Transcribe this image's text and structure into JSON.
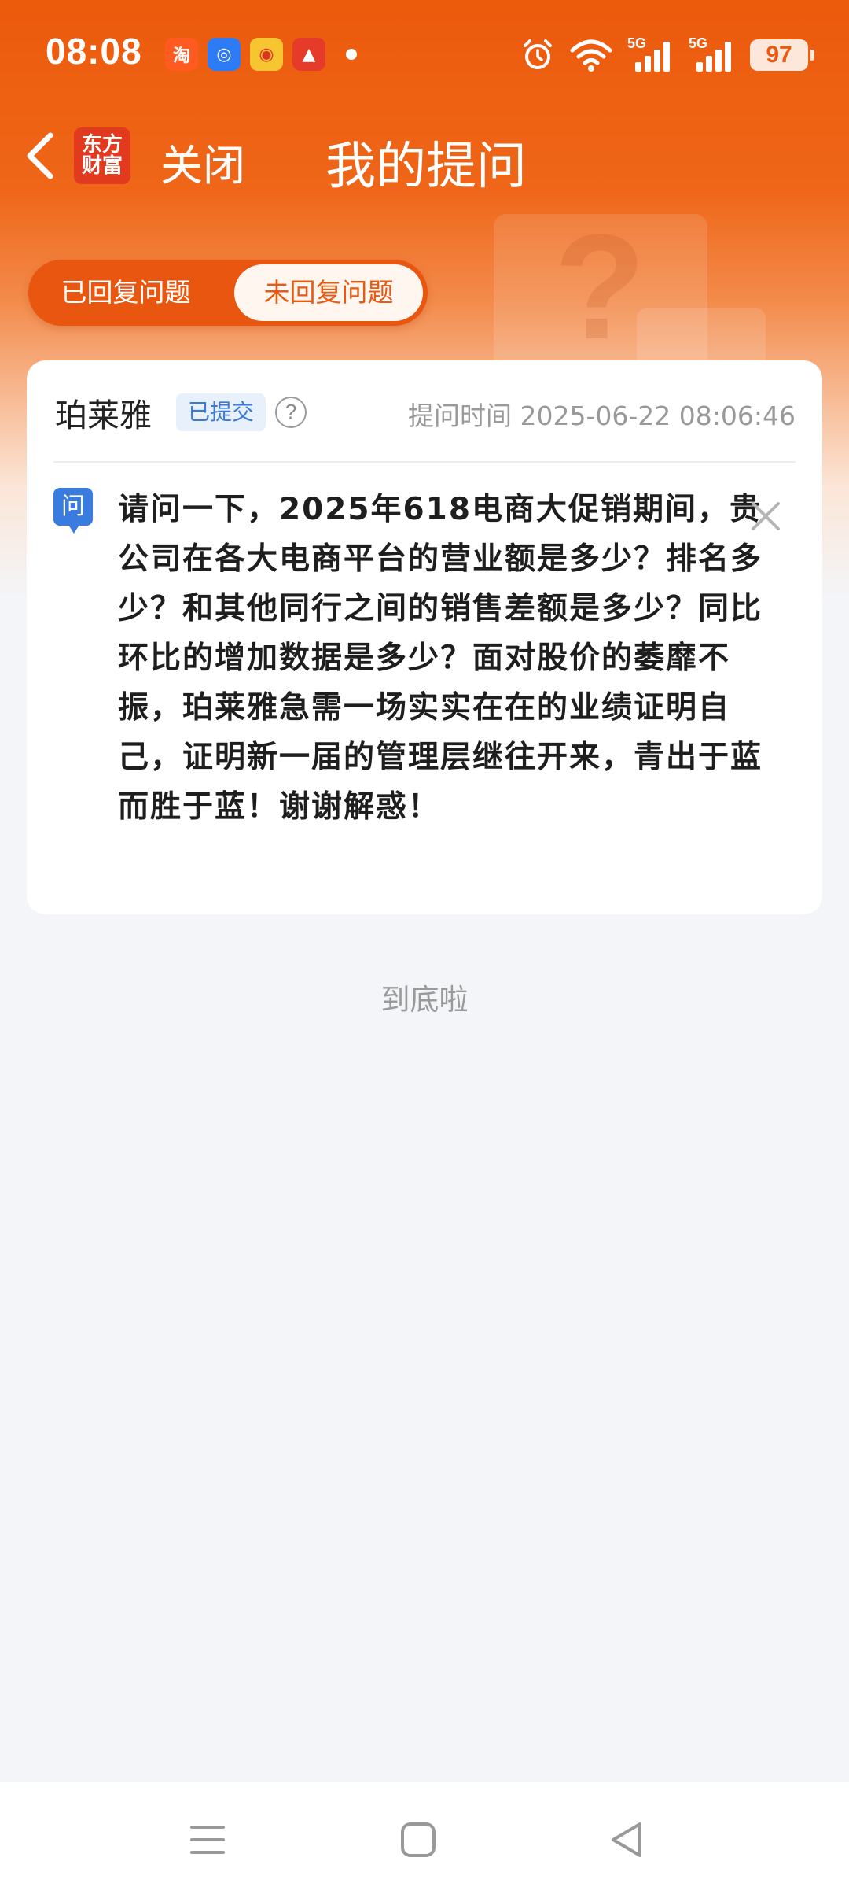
{
  "status_bar": {
    "time": "08:08",
    "battery": "97",
    "signal1_label": "5G",
    "signal2_label": "5G",
    "app_icons": [
      "taobao-icon",
      "qq-browser-icon",
      "weibo-icon",
      "app-red-icon"
    ]
  },
  "nav": {
    "logo_line1": "东方",
    "logo_line2": "财富",
    "close_label": "关闭",
    "title": "我的提问"
  },
  "tabs": {
    "replied": "已回复问题",
    "unreplied": "未回复问题",
    "active": "unreplied"
  },
  "question": {
    "company": "珀莱雅",
    "status": "已提交",
    "help_symbol": "?",
    "time_label": "提问时间 2025-06-22 08:06:46",
    "q_tag": "问",
    "text": "请问一下，2025年618电商大促销期间，贵公司在各大电商平台的营业额是多少？排名多少？和其他同行之间的销售差额是多少？同比环比的增加数据是多少？面对股价的萎靡不振，珀莱雅急需一场实实在在的业绩证明自己，证明新一届的管理层继往开来，青出于蓝而胜于蓝！谢谢解惑！"
  },
  "footer_text": "到底啦",
  "colors": {
    "brand_orange": "#ec5a0c",
    "question_tag_blue": "#3a7be0",
    "badge_blue": "#3a7bd5"
  }
}
